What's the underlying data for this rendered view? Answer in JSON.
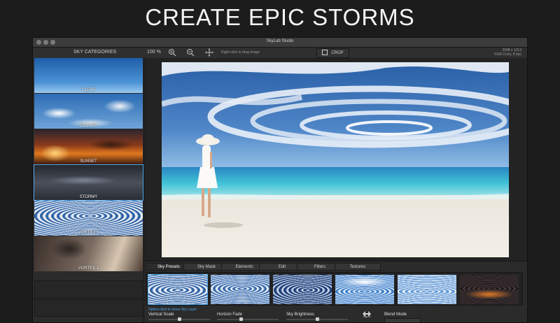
{
  "headline": "CREATE EPIC STORMS",
  "window": {
    "title": "SkyLab Studio"
  },
  "sidebar": {
    "title": "SKY CATEGORIES",
    "items": [
      {
        "label": "CLEAR"
      },
      {
        "label": "CLOUDY"
      },
      {
        "label": "SUNSET"
      },
      {
        "label": "STORMY"
      },
      {
        "label": "VORTEX 1"
      },
      {
        "label": "VORTEX 2"
      }
    ]
  },
  "toolbar": {
    "zoom": "100 %",
    "hint": "Right-click to drag image",
    "crop_label": "CROP",
    "image_size": "2048 x 1313",
    "color_mode": "RGB Color, 8 bpc"
  },
  "bottom": {
    "tabs": [
      "Sky Presets",
      "Sky Mask",
      "Elements",
      "Edit",
      "Filters",
      "Textures"
    ],
    "active_tab": "Sky Presets",
    "hint": "Option-click to move Sky Layer",
    "controls": {
      "vertical_scale": "Vertical Scale",
      "horizon_fade": "Horizon Fade",
      "sky_brightness": "Sky Brightness",
      "flip_x": "Flip X",
      "blend_mode": "Blend Mode"
    }
  },
  "colors": {
    "accent": "#4da6e8",
    "background": "#1c1c1c",
    "panel": "#2b2b2b"
  }
}
